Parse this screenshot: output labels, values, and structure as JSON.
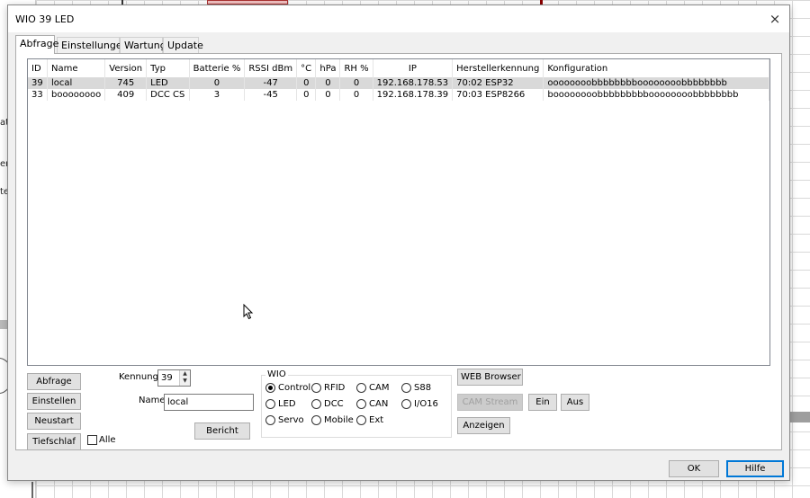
{
  "window": {
    "title": "WIO 39 LED",
    "close_glyph": "×"
  },
  "tabs": [
    {
      "label": "Abfrage",
      "active": true
    },
    {
      "label": "Einstellungen",
      "active": false
    },
    {
      "label": "Wartung",
      "active": false
    },
    {
      "label": "Update",
      "active": false
    }
  ],
  "table": {
    "columns": [
      "ID",
      "Name",
      "Version",
      "Typ",
      "Batterie %",
      "RSSI dBm",
      "°C",
      "hPa",
      "RH %",
      "IP",
      "Herstellerkennung",
      "Konfiguration"
    ],
    "rows": [
      [
        "39",
        "local",
        "745",
        "LED",
        "0",
        "-47",
        "0",
        "0",
        "0",
        "192.168.178.53",
        "70:02 ESP32",
        "oooooooobbbbbbbboooooooobbbbbbbb"
      ],
      [
        "33",
        "boooooooo",
        "409",
        "DCC CS",
        "3",
        "-45",
        "0",
        "0",
        "0",
        "192.168.178.39",
        "70:03 ESP8266",
        "boooooooobbbbbbbbboooooooobbbbbbbb"
      ]
    ],
    "selected_row": 0
  },
  "left_buttons": {
    "abfrage": "Abfrage",
    "einstellen": "Einstellen",
    "neustart": "Neustart",
    "tiefschlaf": "Tiefschlaf"
  },
  "alle": {
    "label": "Alle",
    "checked": false
  },
  "kennung": {
    "label": "Kennung",
    "value": "39"
  },
  "name_field": {
    "label": "Name",
    "value": "local"
  },
  "bericht_button": "Bericht",
  "wio_group": {
    "title": "WIO",
    "options": [
      {
        "label": "Control",
        "selected": true
      },
      {
        "label": "RFID",
        "selected": false
      },
      {
        "label": "CAM",
        "selected": false
      },
      {
        "label": "S88",
        "selected": false
      },
      {
        "label": "LED",
        "selected": false
      },
      {
        "label": "DCC",
        "selected": false
      },
      {
        "label": "CAN",
        "selected": false
      },
      {
        "label": "I/O16",
        "selected": false
      },
      {
        "label": "Servo",
        "selected": false
      },
      {
        "label": "Mobile",
        "selected": false
      },
      {
        "label": "Ext",
        "selected": false
      }
    ]
  },
  "right_buttons": {
    "web_browser": "WEB Browser",
    "cam_stream": "CAM Stream",
    "ein": "Ein",
    "aus": "Aus",
    "anzeigen": "Anzeigen"
  },
  "footer": {
    "ok": "OK",
    "hilfe": "Hilfe"
  },
  "background": {
    "left_labels": [
      "att",
      "en",
      "te"
    ]
  },
  "colors": {
    "selection": "#d9d9d9",
    "dialog_bg": "#f0f0f0",
    "focus_border": "#0078d7"
  }
}
